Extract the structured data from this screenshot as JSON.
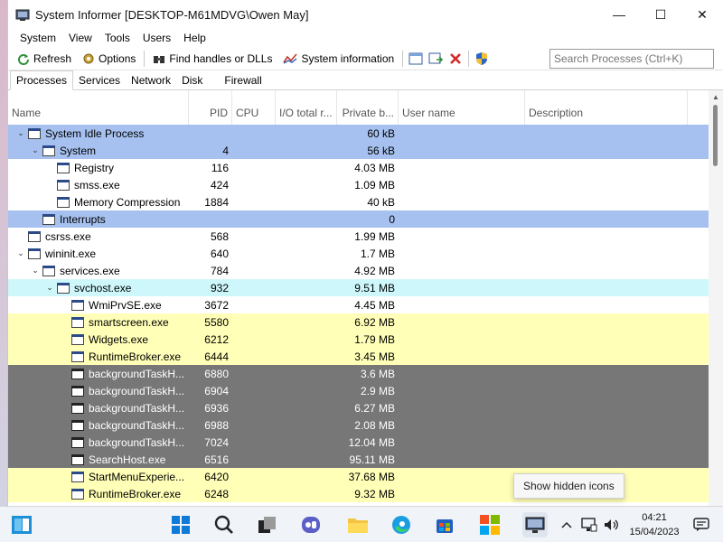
{
  "window": {
    "title": "System Informer [DESKTOP-M61MDVG\\Owen May]",
    "minimize_glyph": "—",
    "maximize_glyph": "☐",
    "close_glyph": "✕"
  },
  "menu": [
    "System",
    "View",
    "Tools",
    "Users",
    "Help"
  ],
  "toolbar": {
    "refresh_label": "Refresh",
    "options_label": "Options",
    "find_label": "Find handles or DLLs",
    "sysinfo_label": "System information",
    "search_placeholder": "Search Processes (Ctrl+K)"
  },
  "tabs": [
    "Processes",
    "Services",
    "Network",
    "Disk",
    "Firewall"
  ],
  "columns": {
    "name": "Name",
    "pid": "PID",
    "cpu": "CPU",
    "io": "I/O total r...",
    "private": "Private b...",
    "user": "User name",
    "description": "Description"
  },
  "processes": [
    {
      "name": "System Idle Process",
      "pid": "",
      "private": "60 kB",
      "indent": 0,
      "expander": "v",
      "color": "blue"
    },
    {
      "name": "System",
      "pid": "4",
      "private": "56 kB",
      "indent": 1,
      "expander": "v",
      "color": "blue"
    },
    {
      "name": "Registry",
      "pid": "116",
      "private": "4.03 MB",
      "indent": 2,
      "expander": "",
      "color": ""
    },
    {
      "name": "smss.exe",
      "pid": "424",
      "private": "1.09 MB",
      "indent": 2,
      "expander": "",
      "color": ""
    },
    {
      "name": "Memory Compression",
      "pid": "1884",
      "private": "40 kB",
      "indent": 2,
      "expander": "",
      "color": ""
    },
    {
      "name": "Interrupts",
      "pid": "",
      "private": "0",
      "indent": 1,
      "expander": "",
      "color": "blue"
    },
    {
      "name": "csrss.exe",
      "pid": "568",
      "private": "1.99 MB",
      "indent": 0,
      "expander": "",
      "color": ""
    },
    {
      "name": "wininit.exe",
      "pid": "640",
      "private": "1.7 MB",
      "indent": 0,
      "expander": "v",
      "color": ""
    },
    {
      "name": "services.exe",
      "pid": "784",
      "private": "4.92 MB",
      "indent": 1,
      "expander": "v",
      "color": ""
    },
    {
      "name": "svchost.exe",
      "pid": "932",
      "private": "9.51 MB",
      "indent": 2,
      "expander": "v",
      "color": "cyan"
    },
    {
      "name": "WmiPrvSE.exe",
      "pid": "3672",
      "private": "4.45 MB",
      "indent": 3,
      "expander": "",
      "color": ""
    },
    {
      "name": "smartscreen.exe",
      "pid": "5580",
      "private": "6.92 MB",
      "indent": 3,
      "expander": "",
      "color": "yellow"
    },
    {
      "name": "Widgets.exe",
      "pid": "6212",
      "private": "1.79 MB",
      "indent": 3,
      "expander": "",
      "color": "yellow"
    },
    {
      "name": "RuntimeBroker.exe",
      "pid": "6444",
      "private": "3.45 MB",
      "indent": 3,
      "expander": "",
      "color": "yellow"
    },
    {
      "name": "backgroundTaskH...",
      "pid": "6880",
      "private": "3.6 MB",
      "indent": 3,
      "expander": "",
      "color": "gray"
    },
    {
      "name": "backgroundTaskH...",
      "pid": "6904",
      "private": "2.9 MB",
      "indent": 3,
      "expander": "",
      "color": "gray"
    },
    {
      "name": "backgroundTaskH...",
      "pid": "6936",
      "private": "6.27 MB",
      "indent": 3,
      "expander": "",
      "color": "gray"
    },
    {
      "name": "backgroundTaskH...",
      "pid": "6988",
      "private": "2.08 MB",
      "indent": 3,
      "expander": "",
      "color": "gray"
    },
    {
      "name": "backgroundTaskH...",
      "pid": "7024",
      "private": "12.04 MB",
      "indent": 3,
      "expander": "",
      "color": "gray"
    },
    {
      "name": "SearchHost.exe",
      "pid": "6516",
      "private": "95.11 MB",
      "indent": 3,
      "expander": "",
      "color": "gray"
    },
    {
      "name": "StartMenuExperie...",
      "pid": "6420",
      "private": "37.68 MB",
      "indent": 3,
      "expander": "",
      "color": "yellow"
    },
    {
      "name": "RuntimeBroker.exe",
      "pid": "6248",
      "private": "9.32 MB",
      "indent": 3,
      "expander": "",
      "color": "yellow"
    }
  ],
  "tooltip": "Show hidden icons",
  "taskbar": {
    "time": "04:21",
    "date": "15/04/2023",
    "icons": [
      "widgets-icon",
      "start-icon",
      "search-icon",
      "task-view-icon",
      "chat-icon",
      "file-explorer-icon",
      "edge-icon",
      "store-icon",
      "app-icon",
      "system-informer-icon"
    ]
  },
  "colors": {
    "blue_row": "#a6c1ef",
    "cyan_row": "#cdf7fa",
    "yellow_row": "#ffffb7",
    "gray_row": "#777777"
  }
}
